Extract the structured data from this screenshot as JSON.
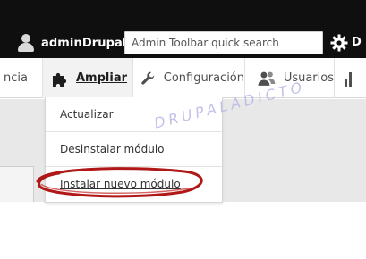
{
  "toolbar": {
    "user_name": "adminDrupal",
    "search_placeholder": "Admin Toolbar quick search",
    "right_label": "D"
  },
  "tray": {
    "items": [
      {
        "label": "ncia",
        "icon": null
      },
      {
        "label": "Ampliar",
        "icon": "puzzle-icon",
        "active": true
      },
      {
        "label": "Configuración",
        "icon": "wrench-icon"
      },
      {
        "label": "Usuarios",
        "icon": "users-icon"
      },
      {
        "label": "",
        "icon": "bar-chart-icon"
      }
    ]
  },
  "dropdown": {
    "items": [
      {
        "label": "Actualizar"
      },
      {
        "label": "Desinstalar módulo"
      },
      {
        "label": "Instalar nuevo módulo",
        "highlighted": true
      }
    ]
  },
  "watermark": "DRUPALADICTO",
  "colors": {
    "toolbar_bg": "#0f0f0f",
    "accent_mark": "#b01818",
    "watermark": "#b8b8e6"
  }
}
